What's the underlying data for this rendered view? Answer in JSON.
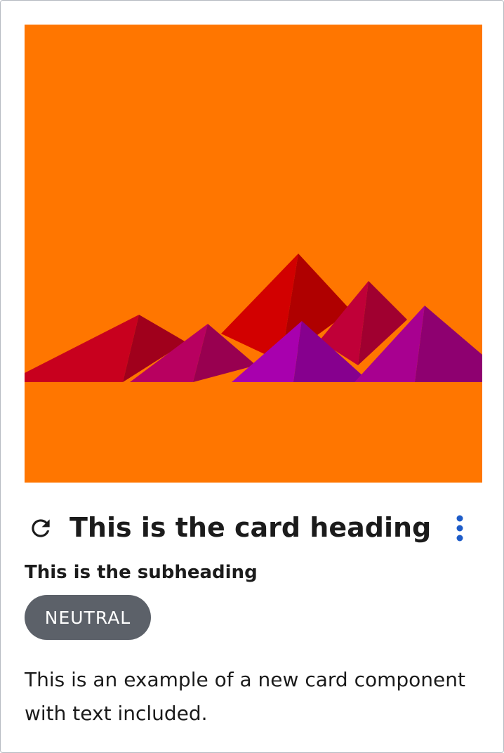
{
  "card": {
    "heading": "This is the card heading",
    "subheading": "This is the subheading",
    "badge": "NEUTRAL",
    "body": "This is an example of a new card component with text included.",
    "refresh_icon": "refresh-icon",
    "menu_icon": "more-vertical-icon"
  },
  "colors": {
    "image_background": "#ff7600",
    "badge_background": "#5c6169",
    "menu_icon": "#1e5cc8",
    "text": "#1b1b1b",
    "border": "#b6bac2"
  }
}
